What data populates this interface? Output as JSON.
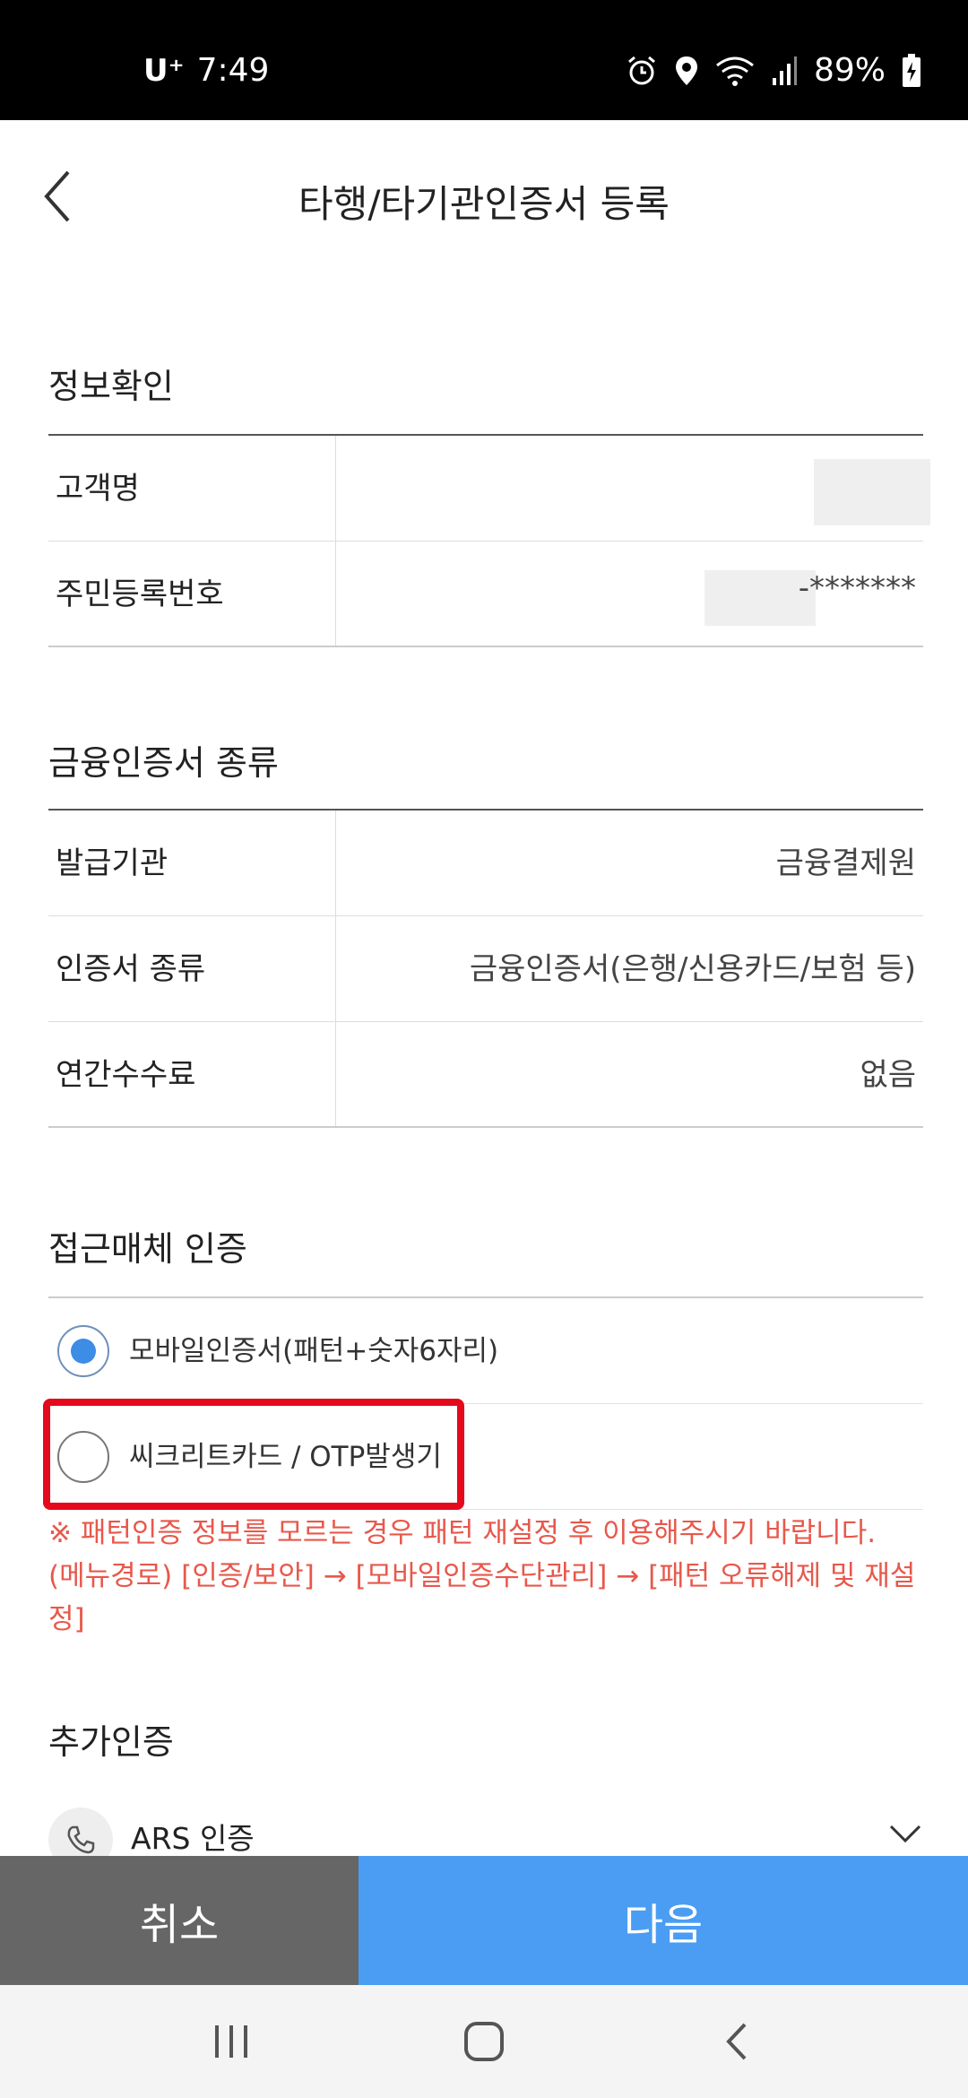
{
  "status_bar": {
    "carrier": "U⁺",
    "time": "7:49",
    "battery": "89%",
    "icons": [
      "alarm-icon",
      "location-icon",
      "wifi-icon",
      "signal-icon",
      "battery-icon"
    ]
  },
  "header": {
    "title": "타행/타기관인증서 등록",
    "back_icon": "back-chevron-icon"
  },
  "info_section": {
    "title": "정보확인",
    "rows": [
      {
        "label": "고객명",
        "value": ""
      },
      {
        "label": "주민등록번호",
        "value": "-*******"
      }
    ]
  },
  "cert_section": {
    "title": "금융인증서 종류",
    "rows": [
      {
        "label": "발급기관",
        "value": "금융결제원"
      },
      {
        "label": "인증서 종류",
        "value": "금융인증서(은행/신용카드/보험 등)"
      },
      {
        "label": "연간수수료",
        "value": "없음"
      }
    ]
  },
  "access_section": {
    "title": "접근매체 인증",
    "options": [
      {
        "label": "모바일인증서(패턴+숫자6자리)",
        "selected": true
      },
      {
        "label": "씨크리트카드 / OTP발생기",
        "selected": false
      }
    ],
    "notice": "※ 패턴인증 정보를 모르는 경우 패턴 재설정 후 이용해주시기 바랍니다. (메뉴경로) [인증/보안] → [모바일인증수단관리] → [패턴 오류해제 및 재설정]"
  },
  "extra_section": {
    "title": "추가인증",
    "ars_label": "ARS 인증",
    "ars_icon": "phone-icon",
    "chevron_icon": "chevron-down-icon"
  },
  "buttons": {
    "cancel": "취소",
    "next": "다음"
  },
  "colors": {
    "accent_blue": "#4a9df3",
    "cancel_gray": "#666666",
    "notice_red": "#e8584b",
    "highlight_red": "#e5091c"
  }
}
